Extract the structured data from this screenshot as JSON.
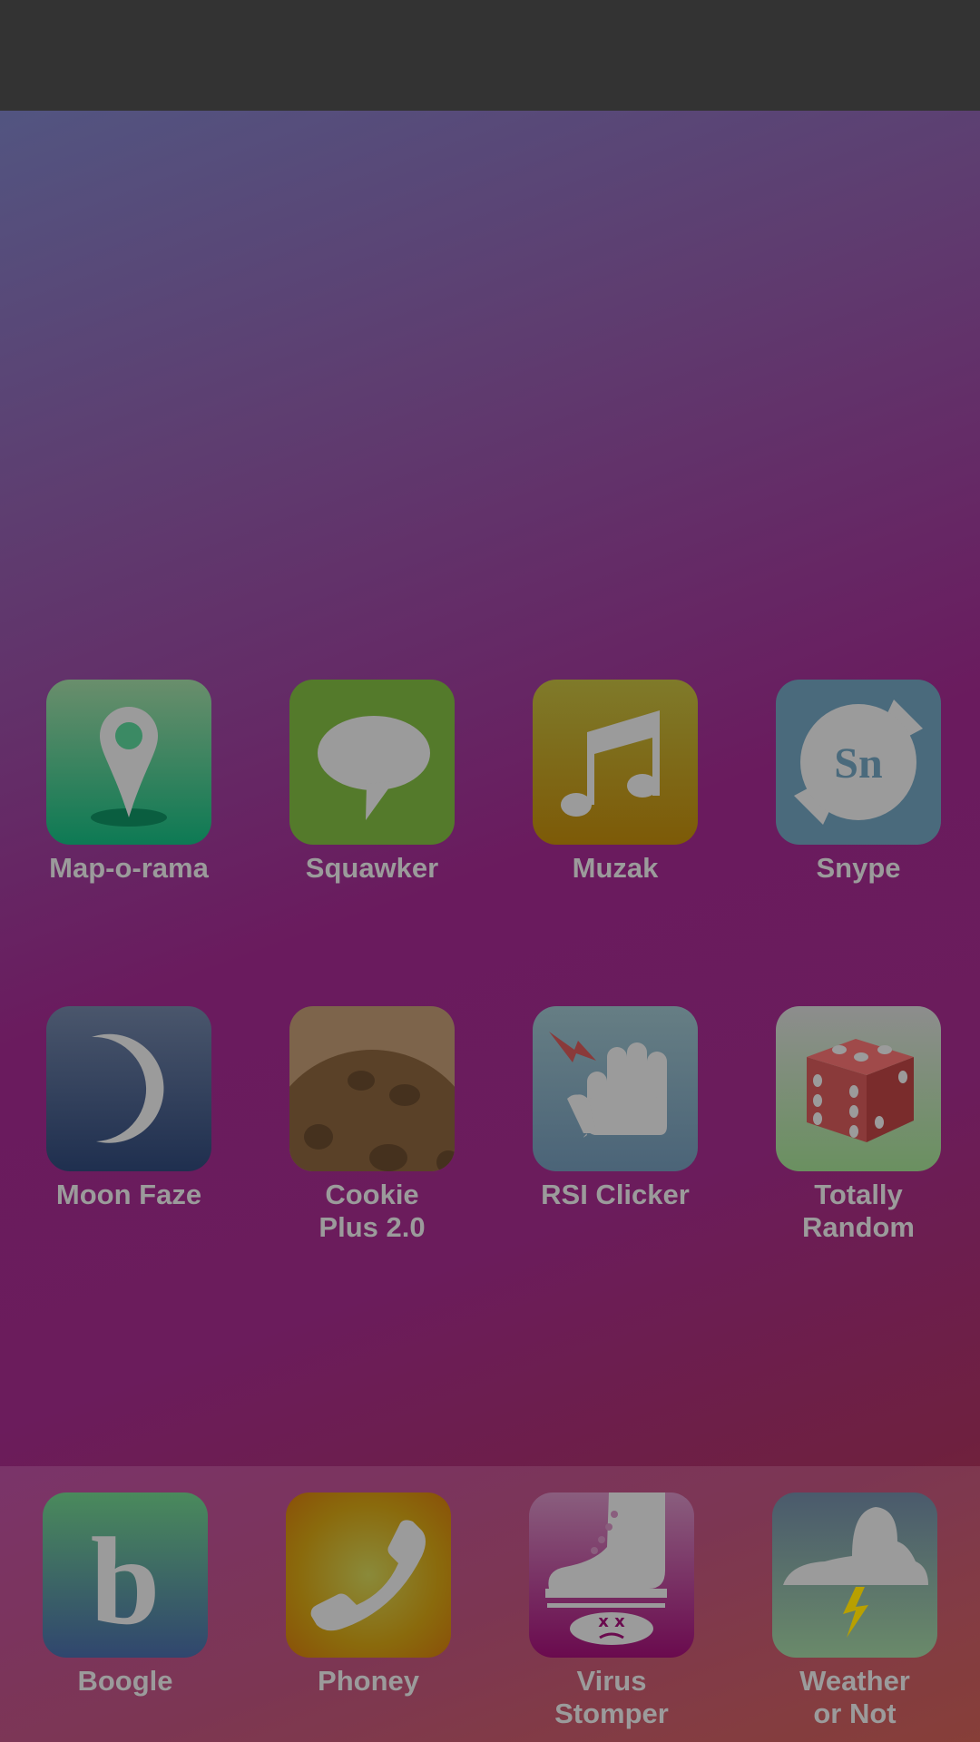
{
  "colors": {
    "label": "#9b9b9b",
    "status_bar": "#333333"
  },
  "home_screen": {
    "rows": [
      [
        {
          "label": "Map-o-rama",
          "icon": "map-pin-icon"
        },
        {
          "label": "Squawker",
          "icon": "speech-bubble-icon"
        },
        {
          "label": "Muzak",
          "icon": "music-note-icon"
        },
        {
          "label": "Snype",
          "icon": "snype-logo-icon"
        }
      ],
      [
        {
          "label": "Moon Faze",
          "icon": "crescent-moon-icon"
        },
        {
          "label": "Cookie\nPlus 2.0",
          "icon": "cookie-icon"
        },
        {
          "label": "RSI Clicker",
          "icon": "hand-click-icon"
        },
        {
          "label": "Totally\nRandom",
          "icon": "dice-icon"
        }
      ]
    ]
  },
  "dock": {
    "apps": [
      {
        "label": "Boogle",
        "icon": "boogle-b-icon"
      },
      {
        "label": "Phoney",
        "icon": "phone-handset-icon"
      },
      {
        "label": "Virus\nStomper",
        "icon": "boot-stomp-icon"
      },
      {
        "label": "Weather\nor Not",
        "icon": "storm-cloud-icon"
      }
    ]
  }
}
